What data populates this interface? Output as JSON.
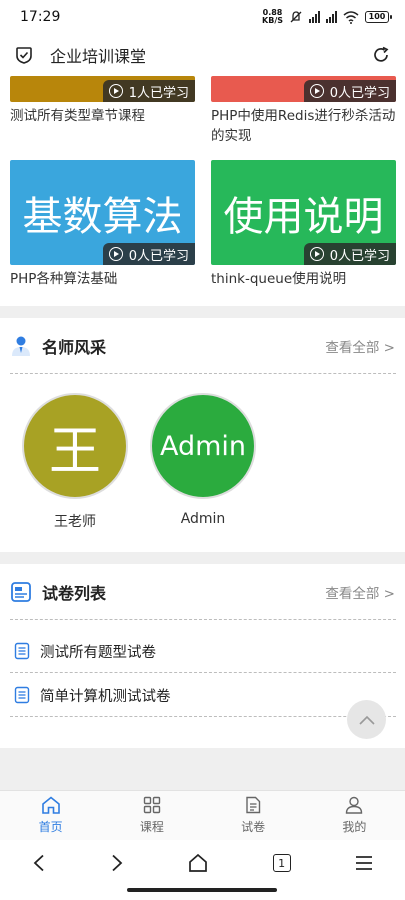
{
  "status_bar": {
    "time": "17:29",
    "net_speed_value": "0.88",
    "net_speed_unit": "KB/S",
    "battery": "100"
  },
  "header": {
    "title": "企业培训课堂"
  },
  "courses": [
    {
      "title": "测试所有类型章节课程",
      "learners": "1人已学习",
      "color": "#b8860b",
      "cover_text": ""
    },
    {
      "title": "PHP中使用Redis进行秒杀活动的实现",
      "learners": "0人已学习",
      "color": "#e85a4f",
      "cover_text": ""
    },
    {
      "title": "PHP各种算法基础",
      "learners": "0人已学习",
      "color": "#3aa6dd",
      "cover_text": "基数算法"
    },
    {
      "title": "think-queue使用说明",
      "learners": "0人已学习",
      "color": "#27b85a",
      "cover_text": "使用说明"
    }
  ],
  "teachers_section": {
    "title": "名师风采",
    "more": "查看全部 >",
    "teachers": [
      {
        "avatar_text": "王",
        "name": "王老师",
        "color": "#a8a224"
      },
      {
        "avatar_text": "Admin",
        "name": "Admin",
        "color": "#2bab3e"
      }
    ]
  },
  "papers_section": {
    "title": "试卷列表",
    "more": "查看全部 >",
    "items": [
      {
        "label": "测试所有题型试卷"
      },
      {
        "label": "简单计算机测试试卷"
      }
    ]
  },
  "tabbar": {
    "tabs": [
      {
        "label": "首页",
        "icon": "home-icon",
        "active": true
      },
      {
        "label": "课程",
        "icon": "grid-icon",
        "active": false
      },
      {
        "label": "试卷",
        "icon": "document-icon",
        "active": false
      },
      {
        "label": "我的",
        "icon": "person-icon",
        "active": false
      }
    ]
  },
  "nav_bar": {
    "tabs_count": "1"
  },
  "colors": {
    "accent": "#2f7de1",
    "band": "#efefef"
  }
}
